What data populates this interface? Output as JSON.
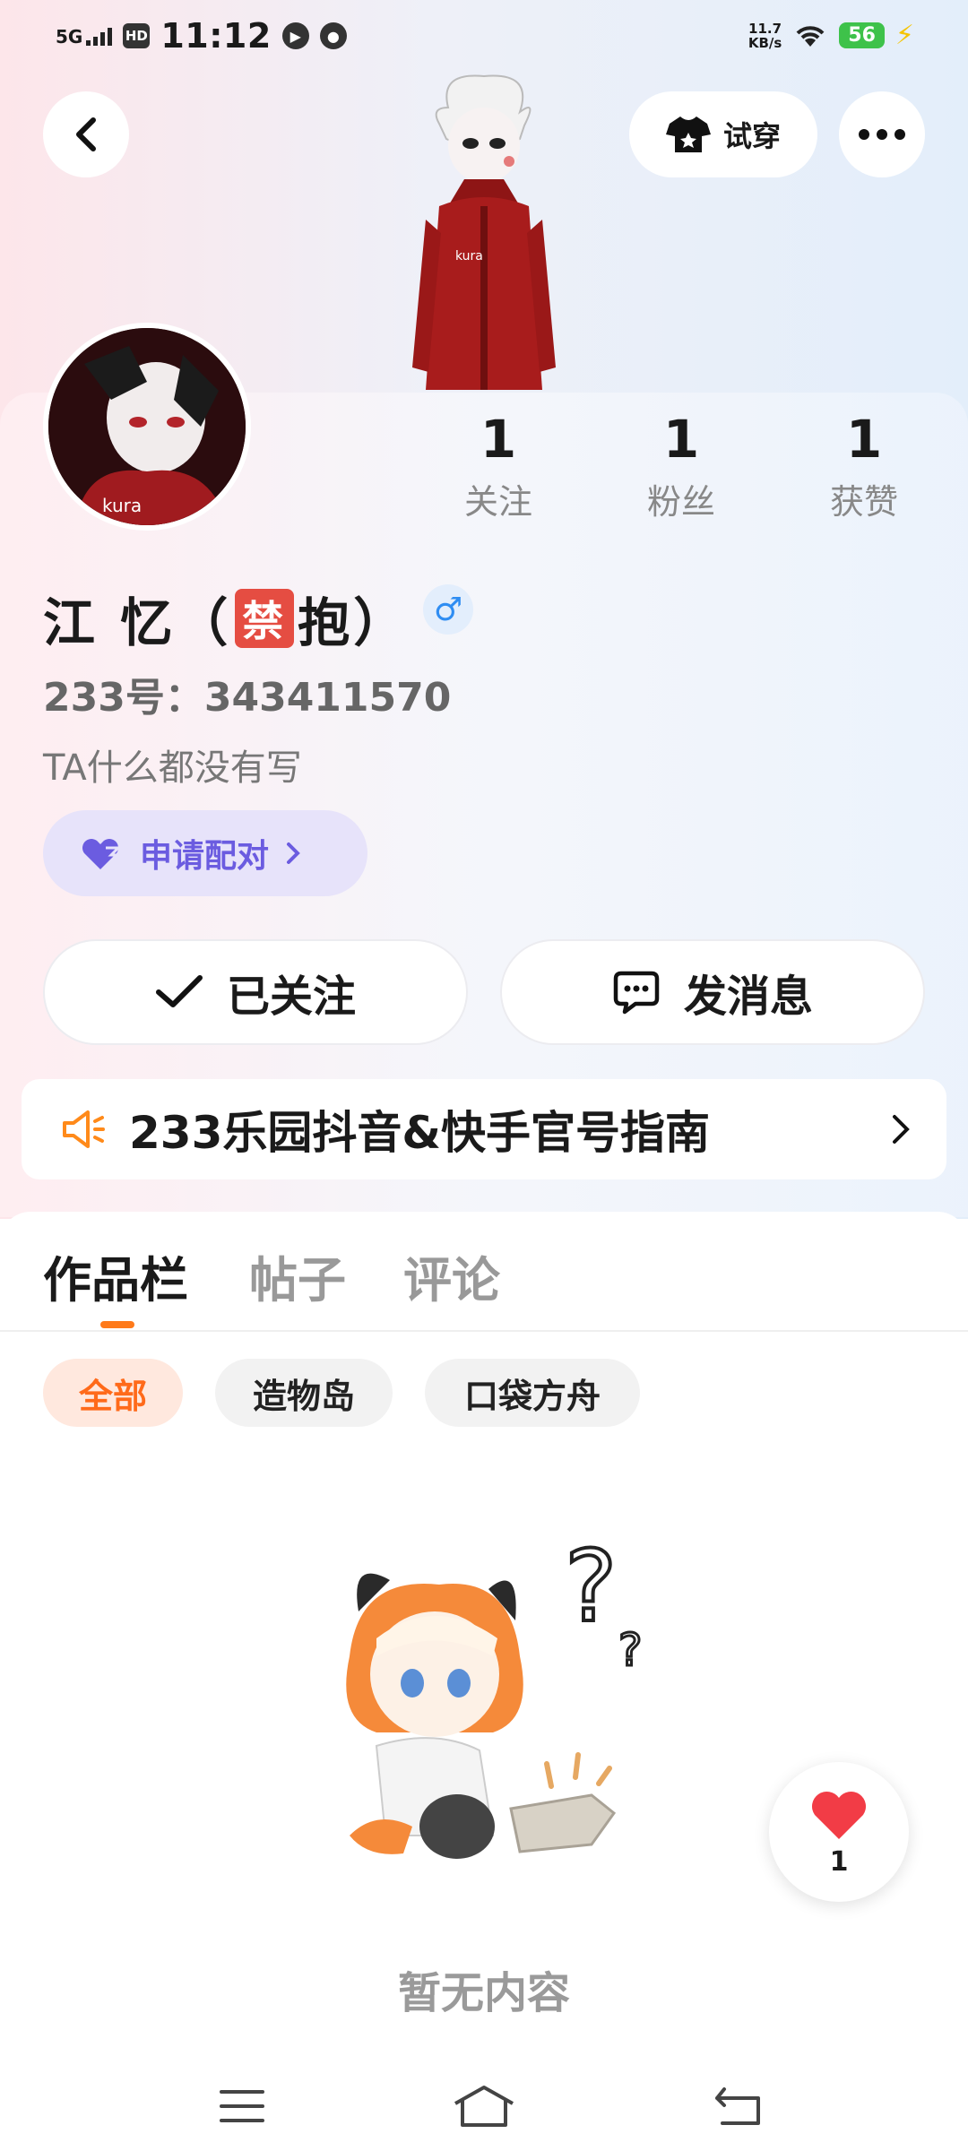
{
  "status_bar": {
    "network": "5G",
    "hd": "HD",
    "time": "11:12",
    "speed_value": "11.7",
    "speed_unit": "KB/s",
    "battery": "56"
  },
  "header": {
    "tryon_label": "试穿"
  },
  "profile": {
    "stats": [
      {
        "value": "1",
        "label": "关注"
      },
      {
        "value": "1",
        "label": "粉丝"
      },
      {
        "value": "1",
        "label": "获赞"
      }
    ],
    "nickname_part1": "江 忆（",
    "nickname_ban": "禁",
    "nickname_part2": "抱）",
    "gender_symbol": "♂",
    "uid": "233号：343411570",
    "bio": "TA什么都没有写",
    "pair_label": "申请配对",
    "followed_label": "已关注",
    "message_label": "发消息",
    "guide_text": "233乐园抖音&快手官号指南"
  },
  "tabs": [
    "作品栏",
    "帖子",
    "评论"
  ],
  "filters": [
    "全部",
    "造物岛",
    "口袋方舟"
  ],
  "empty_text": "暂无内容",
  "like_count": "1",
  "colors": {
    "accent_orange": "#ff7a1a",
    "pair_purple": "#6b5ce0",
    "gender_blue": "#2f8df2"
  }
}
